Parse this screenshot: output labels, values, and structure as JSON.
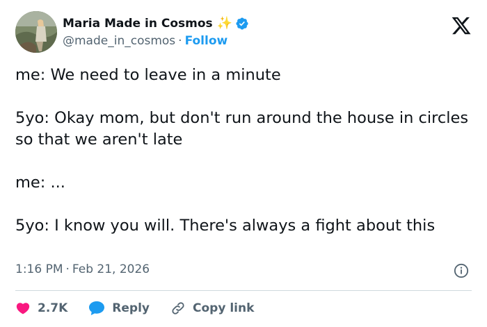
{
  "author": {
    "display_name": "Maria Made in Cosmos",
    "handle": "@made_in_cosmos",
    "separator": "·",
    "follow_label": "Follow"
  },
  "tweet": {
    "text": "me: We need to leave in a minute\n\n5yo: Okay mom, but don't run around the house in circles so that we aren't late\n\nme: ...\n\n5yo: I know you will. There's always a fight about this",
    "time": "1:16 PM",
    "separator": "·",
    "date": "Feb 21, 2026"
  },
  "actions": {
    "likes_count": "2.7K",
    "reply_label": "Reply",
    "copy_link_label": "Copy link"
  },
  "icons": {
    "sparkle": "sparkle-icon",
    "verified": "verified-badge-icon",
    "brand": "x-logo-icon",
    "info": "info-icon",
    "like": "heart-icon",
    "reply": "speech-bubble-icon",
    "copy": "link-icon"
  },
  "colors": {
    "accent": "#1d9bf0",
    "like": "#f91880",
    "text": "#0f1419",
    "muted": "#536471"
  }
}
